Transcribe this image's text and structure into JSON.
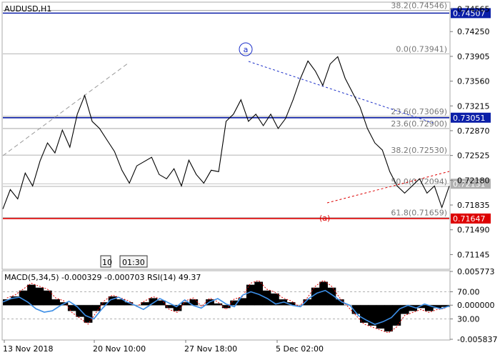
{
  "chart_data": [
    {
      "type": "line",
      "symbol": "AUDUSD,H1",
      "title": "AUDUSD,H1",
      "ylim": [
        0.7095,
        0.7465
      ],
      "y_ticks": [
        "0.74565",
        "0.74250",
        "0.73905",
        "0.73560",
        "0.73215",
        "0.72870",
        "0.72525",
        "0.72180",
        "0.71835",
        "0.71490",
        "0.71145"
      ],
      "x_labels": [
        "13 Nov 2018",
        "20 Nov 10:00",
        "27 Nov 18:00",
        "5 Dec 02:00"
      ],
      "series": [
        {
          "values": [
            0.7178,
            0.7205,
            0.7192,
            0.7228,
            0.721,
            0.7245,
            0.727,
            0.7256,
            0.7288,
            0.7264,
            0.731,
            0.7336,
            0.73,
            0.729,
            0.7274,
            0.7258,
            0.7232,
            0.7214,
            0.7238,
            0.7244,
            0.725,
            0.7226,
            0.722,
            0.7234,
            0.721,
            0.7246,
            0.7226,
            0.7214,
            0.7232,
            0.723,
            0.73,
            0.731,
            0.733,
            0.73,
            0.731,
            0.7294,
            0.731,
            0.729,
            0.7304,
            0.733,
            0.736,
            0.7384,
            0.737,
            0.735,
            0.738,
            0.739,
            0.736,
            0.734,
            0.732,
            0.729,
            0.727,
            0.726,
            0.723,
            0.721,
            0.72,
            0.721,
            0.722,
            0.72,
            0.721,
            0.718,
            0.721
          ]
        }
      ],
      "levels": [
        {
          "label": "38.2(0.74546)",
          "value": 0.74546
        },
        {
          "label": "0.0(0.73941)",
          "value": 0.73941
        },
        {
          "label": "23.6(0.73069)",
          "value": 0.73069
        },
        {
          "label": "23.6(0.72900)",
          "value": 0.729
        },
        {
          "label": "38.2(0.72530)",
          "value": 0.7253
        },
        {
          "label": "50.0(0.72094)",
          "value": 0.72094
        },
        {
          "label": "61.8(0.71659)",
          "value": 0.71659
        }
      ],
      "price_lines": [
        {
          "label": "0.74507",
          "value": 0.74507,
          "color": "#0b1fa8"
        },
        {
          "label": "0.73051",
          "value": 0.73051,
          "color": "#0b1fa8"
        },
        {
          "label": "0.72131",
          "value": 0.72131,
          "color": "#b0b0b0"
        },
        {
          "label": "0.71647",
          "value": 0.71647,
          "color": "#dd0000"
        }
      ],
      "wave_labels": [
        {
          "text": "a",
          "color": "#1a2ec8"
        },
        {
          "text": "(a)",
          "color": "#dd0000"
        }
      ],
      "period_buttons": [
        "10",
        "01:30"
      ]
    },
    {
      "type": "area",
      "header": "MACD(5,34,5) -0.000329 -0.000703 RSI(14) 49.37",
      "ylim": [
        -0.005837,
        0.005773
      ],
      "y_ticks": [
        "0.005773",
        "70.00",
        "0.000000",
        "30.00",
        "-0.005837"
      ],
      "rsi_levels": [
        70,
        30
      ],
      "macd_values": [
        0.001,
        0.0015,
        0.0025,
        0.0035,
        0.003,
        0.0025,
        0.001,
        0.0005,
        -0.001,
        -0.002,
        -0.003,
        -0.001,
        0.0005,
        0.0015,
        0.001,
        0.0005,
        0.0,
        0.0005,
        0.0012,
        0.0008,
        -0.0005,
        -0.001,
        0.0005,
        0.001,
        0.0,
        0.001,
        0.0003,
        -0.0005,
        0.0008,
        0.0012,
        0.0035,
        0.004,
        0.0025,
        0.002,
        0.001,
        0.0005,
        0.0,
        0.001,
        0.003,
        0.004,
        0.003,
        0.001,
        0.0,
        -0.0015,
        -0.003,
        -0.0035,
        -0.004,
        -0.0045,
        -0.0035,
        -0.0015,
        -0.001,
        -0.0005,
        -0.001,
        -0.0005,
        -0.0003
      ],
      "rsi_values": [
        55,
        60,
        62,
        55,
        45,
        40,
        42,
        50,
        56,
        48,
        35,
        30,
        45,
        58,
        62,
        55,
        50,
        44,
        52,
        60,
        54,
        48,
        58,
        50,
        46,
        55,
        60,
        52,
        48,
        65,
        70,
        66,
        60,
        52,
        55,
        50,
        48,
        60,
        68,
        72,
        64,
        55,
        50,
        35,
        28,
        22,
        26,
        32,
        45,
        50,
        46,
        52,
        48,
        45,
        49
      ]
    }
  ]
}
